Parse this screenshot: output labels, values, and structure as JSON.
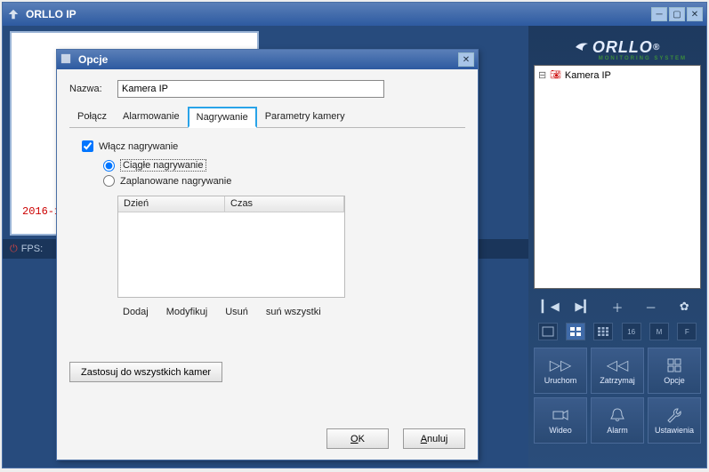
{
  "app": {
    "title": "ORLLO IP"
  },
  "brand": {
    "name": "ORLLO",
    "sub": "MONITORING SYSTEM",
    "registered": "®"
  },
  "video": {
    "timestamp_partial": "2016-1"
  },
  "status": {
    "fps_label": "FPS:"
  },
  "tree": {
    "items": [
      {
        "label": "Kamera IP"
      }
    ]
  },
  "layout_buttons": [
    {
      "id": "layout-1",
      "label": ""
    },
    {
      "id": "layout-4",
      "label": ""
    },
    {
      "id": "layout-9",
      "label": ""
    },
    {
      "id": "layout-16",
      "label": "16"
    },
    {
      "id": "layout-m",
      "label": "M"
    },
    {
      "id": "layout-f",
      "label": "F"
    }
  ],
  "actions": {
    "run": "Uruchom",
    "stop": "Zatrzymaj",
    "options": "Opcje",
    "video": "Wideo",
    "alarm": "Alarm",
    "settings": "Ustawienia"
  },
  "dialog": {
    "title": "Opcje",
    "name_label": "Nazwa:",
    "name_value": "Kamera IP",
    "tabs": {
      "connect": "Połącz",
      "alarm": "Alarmowanie",
      "recording": "Nagrywanie",
      "params": "Parametry kamery"
    },
    "enable_recording": "Włącz nagrywanie",
    "mode": {
      "continuous": "Ciągłe nagrywanie",
      "scheduled": "Zaplanowane nagrywanie"
    },
    "schedule": {
      "col_day": "Dzień",
      "col_time": "Czas",
      "rows": []
    },
    "sched_actions": {
      "add": "Dodaj",
      "modify": "Modyfikuj",
      "remove": "Usuń",
      "remove_all": "suń wszystki"
    },
    "apply_all": "Zastosuj do wszystkich kamer",
    "ok": "OK",
    "cancel": "Anuluj"
  }
}
